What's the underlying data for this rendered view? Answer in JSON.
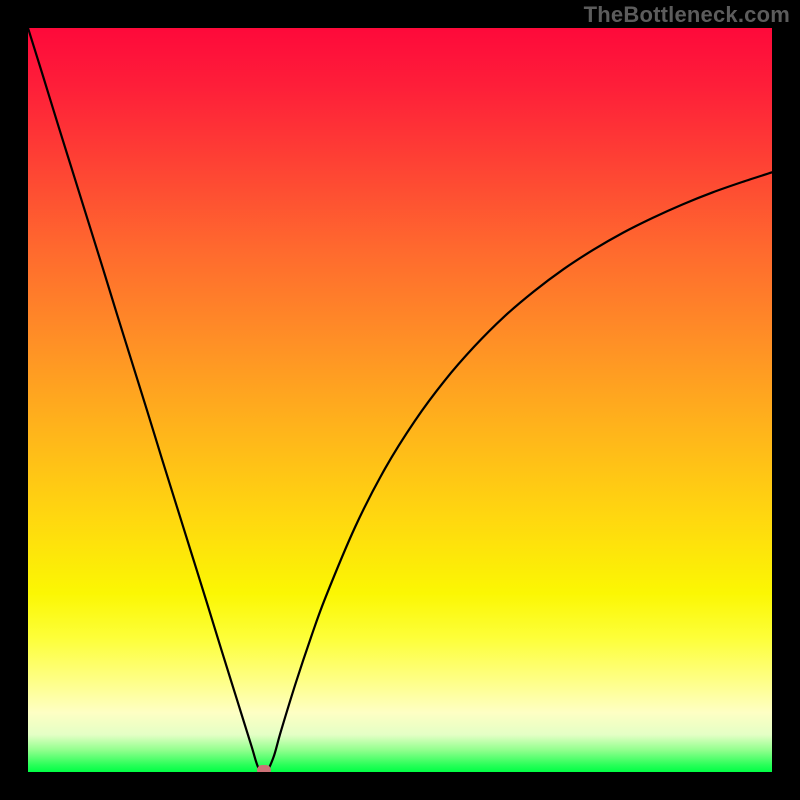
{
  "watermark": "TheBottleneck.com",
  "colors": {
    "frame_bg": "#000000",
    "curve": "#000000",
    "marker": "#cd7277",
    "watermark": "#5c5c5c"
  },
  "chart_data": {
    "type": "line",
    "title": "",
    "xlabel": "",
    "ylabel": "",
    "x": [
      0,
      2,
      4,
      6,
      8,
      10,
      12,
      14,
      16,
      18,
      20,
      22,
      24,
      26,
      28,
      30,
      31,
      32,
      33,
      34,
      36,
      38,
      40,
      44,
      48,
      52,
      56,
      60,
      64,
      68,
      72,
      76,
      80,
      84,
      88,
      92,
      96,
      100
    ],
    "values": [
      100,
      93.6,
      87.1,
      80.7,
      74.3,
      67.9,
      61.4,
      55.0,
      48.6,
      42.1,
      35.7,
      29.3,
      22.9,
      16.4,
      10.0,
      3.6,
      0.5,
      0.0,
      2.0,
      5.5,
      12.0,
      18.0,
      23.5,
      33.0,
      40.8,
      47.2,
      52.6,
      57.2,
      61.2,
      64.6,
      67.6,
      70.2,
      72.5,
      74.5,
      76.3,
      77.9,
      79.3,
      80.6
    ],
    "xlim": [
      0,
      100
    ],
    "ylim": [
      0,
      100
    ],
    "minimum": {
      "x": 31.7,
      "y": 0
    }
  }
}
